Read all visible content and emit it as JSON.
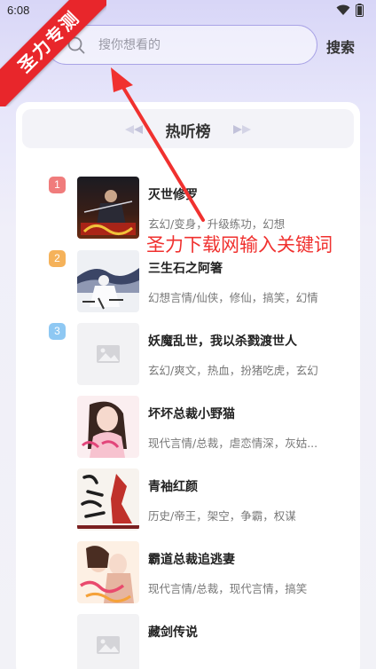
{
  "status_bar": {
    "time": "6:08"
  },
  "watermark": {
    "ribbon_text": "圣力专测"
  },
  "annotation": {
    "text": "圣力下载网输入关键词"
  },
  "search": {
    "placeholder": "搜你想看的",
    "button_label": "搜索"
  },
  "hot_list": {
    "title": "热听榜",
    "items": [
      {
        "rank": "1",
        "rank_color": "#f07c7c",
        "title": "灭世修罗",
        "tags": "玄幻/变身，升级练功，幻想",
        "cover": "cover-mieshi"
      },
      {
        "rank": "2",
        "rank_color": "#f5b25a",
        "title": "三生石之阿箸",
        "tags": "幻想言情/仙侠，修仙，搞笑，幻情",
        "cover": "cover-sanshengshi"
      },
      {
        "rank": "3",
        "rank_color": "#8ec8f3",
        "title": "妖魔乱世，我以杀戮渡世人",
        "tags": "玄幻/爽文，热血，扮猪吃虎，玄幻",
        "cover": "cover-placeholder"
      },
      {
        "rank": "",
        "rank_color": "",
        "title": "坏坏总裁小野猫",
        "tags": "现代言情/总裁，虐恋情深，灰姑...",
        "cover": "cover-huaihuai"
      },
      {
        "rank": "",
        "rank_color": "",
        "title": "青袖红颜",
        "tags": "历史/帝王，架空，争霸，权谋",
        "cover": "cover-qingxiu"
      },
      {
        "rank": "",
        "rank_color": "",
        "title": "霸道总裁追逃妻",
        "tags": "现代言情/总裁，现代言情，搞笑",
        "cover": "cover-badao"
      },
      {
        "rank": "",
        "rank_color": "",
        "title": "藏剑传说",
        "tags": "",
        "cover": "cover-placeholder"
      }
    ]
  }
}
